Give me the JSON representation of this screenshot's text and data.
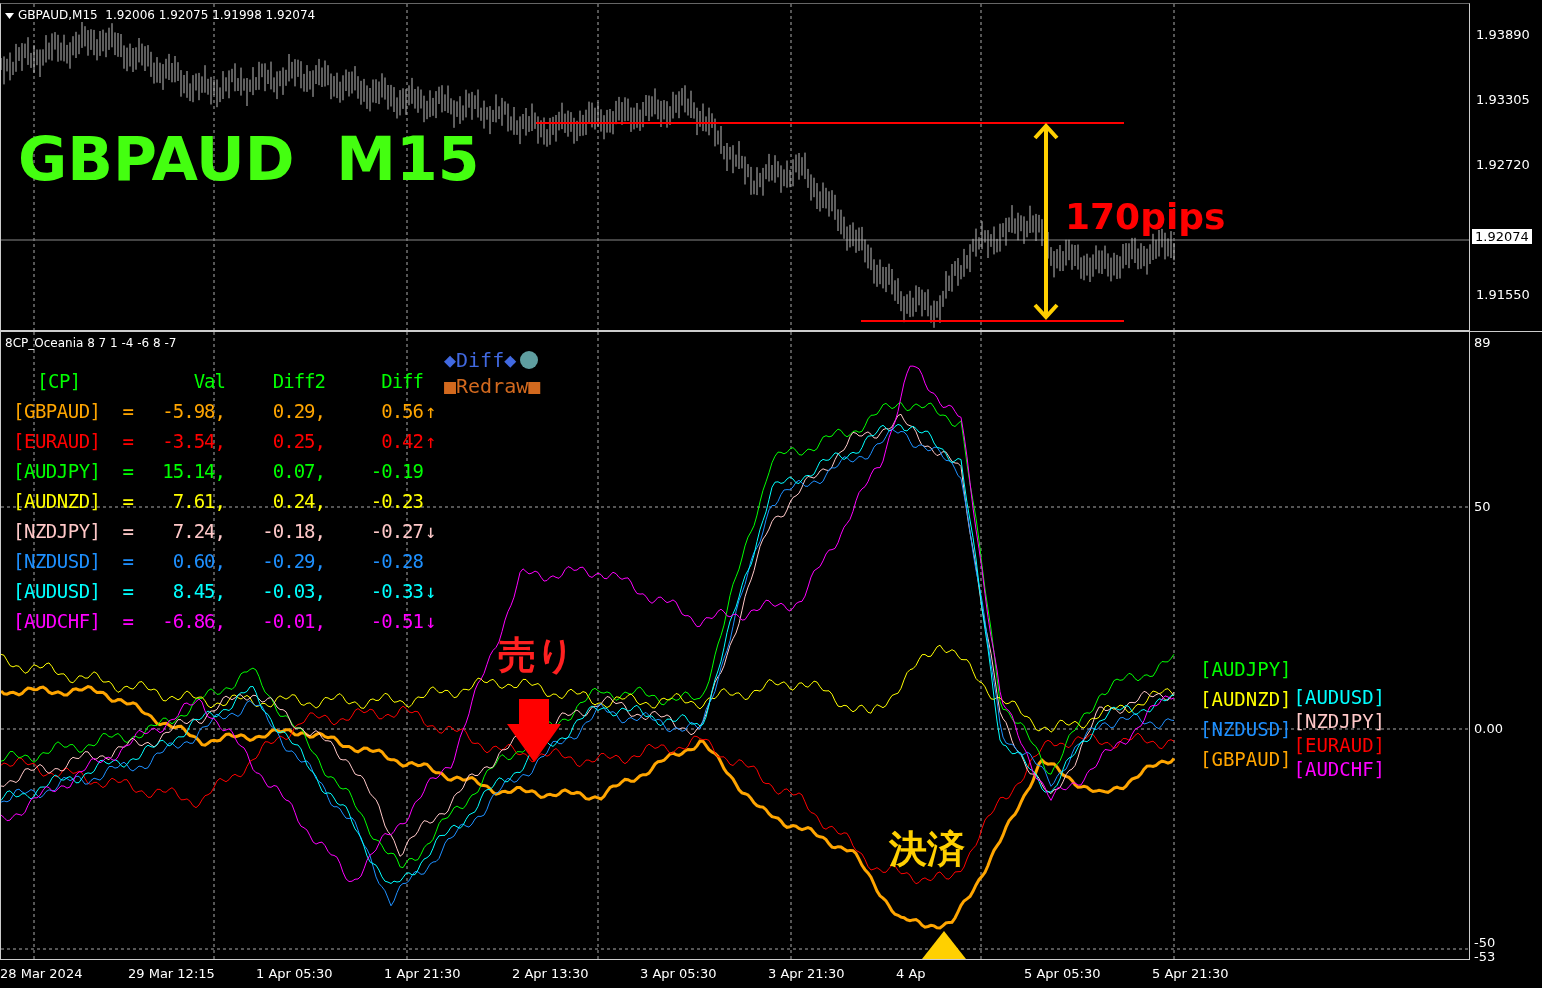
{
  "price_chart": {
    "header": "GBPAUD,M15  1.92006 1.92075 1.91998 1.92074",
    "title": "GBPAUD  M15",
    "annotation": "170pips",
    "price_axis": [
      "1.93890",
      "1.93305",
      "1.92720",
      "1.91550"
    ],
    "current_price": "1.92074"
  },
  "indicator": {
    "name": "8CP_Oceania 8 7 1 -4 -6 8 -7",
    "columns": [
      "[CP]",
      "Val",
      "Diff2",
      "Diff"
    ],
    "rows": [
      {
        "pair": "[GBPAUD]",
        "eq": "=",
        "val": "-5.98,",
        "diff2": "0.29,",
        "diff": "0.56",
        "arrow": "↑",
        "color": "#ffa500"
      },
      {
        "pair": "[EURAUD]",
        "eq": "=",
        "val": "-3.54,",
        "diff2": "0.25,",
        "diff": "0.42",
        "arrow": "↑",
        "color": "#ff0000"
      },
      {
        "pair": "[AUDJPY]",
        "eq": "=",
        "val": "15.14,",
        "diff2": "0.07,",
        "diff": "-0.19",
        "color": "#00ff00"
      },
      {
        "pair": "[AUDNZD]",
        "eq": "=",
        "val": "7.61,",
        "diff2": "0.24,",
        "diff": "-0.23",
        "color": "#ffff00"
      },
      {
        "pair": "[NZDJPY]",
        "eq": "=",
        "val": "7.24,",
        "diff2": "-0.18,",
        "diff": "-0.27",
        "arrow": "↓",
        "color": "#ffc8c8"
      },
      {
        "pair": "[NZDUSD]",
        "eq": "=",
        "val": "0.60,",
        "diff2": "-0.29,",
        "diff": "-0.28",
        "color": "#1e90ff"
      },
      {
        "pair": "[AUDUSD]",
        "eq": "=",
        "val": "8.45,",
        "diff2": "-0.03,",
        "diff": "-0.33",
        "arrow": "↓",
        "color": "#00ffff"
      },
      {
        "pair": "[AUDCHF]",
        "eq": "=",
        "val": "-6.86,",
        "diff2": "-0.01,",
        "diff": "-0.51",
        "arrow": "↓",
        "color": "#ff00ff"
      }
    ],
    "buttons": [
      {
        "label": "◆Diff◆",
        "kind": "diff"
      },
      {
        "label": "■Redraw■",
        "kind": "redraw"
      }
    ],
    "sell_label": "売り",
    "close_label": "決済",
    "legend": {
      "left": [
        {
          "label": "[AUDJPY]",
          "color": "#00ff00"
        },
        {
          "label": "[AUDNZD]",
          "color": "#ffff00"
        },
        {
          "label": "[NZDUSD]",
          "color": "#1e90ff"
        },
        {
          "label": "[GBPAUD]",
          "color": "#ffa500"
        }
      ],
      "right": [
        {
          "label": "[AUDUSD]",
          "color": "#00ffff"
        },
        {
          "label": "[NZDJPY]",
          "color": "#ffc8c8"
        },
        {
          "label": "[EURAUD]",
          "color": "#ff0000"
        },
        {
          "label": "[AUDCHF]",
          "color": "#ff00ff"
        }
      ]
    },
    "axis": [
      "89",
      "50",
      "0.00",
      "-50",
      "-53"
    ]
  },
  "time_axis": [
    "28 Mar 2024",
    "29 Mar 12:15",
    "1 Apr 05:30",
    "1 Apr 21:30",
    "2 Apr 13:30",
    "3 Apr 05:30",
    "3 Apr 21:30",
    "4 Ap",
    "5 Apr 05:30",
    "5 Apr 21:30"
  ]
}
